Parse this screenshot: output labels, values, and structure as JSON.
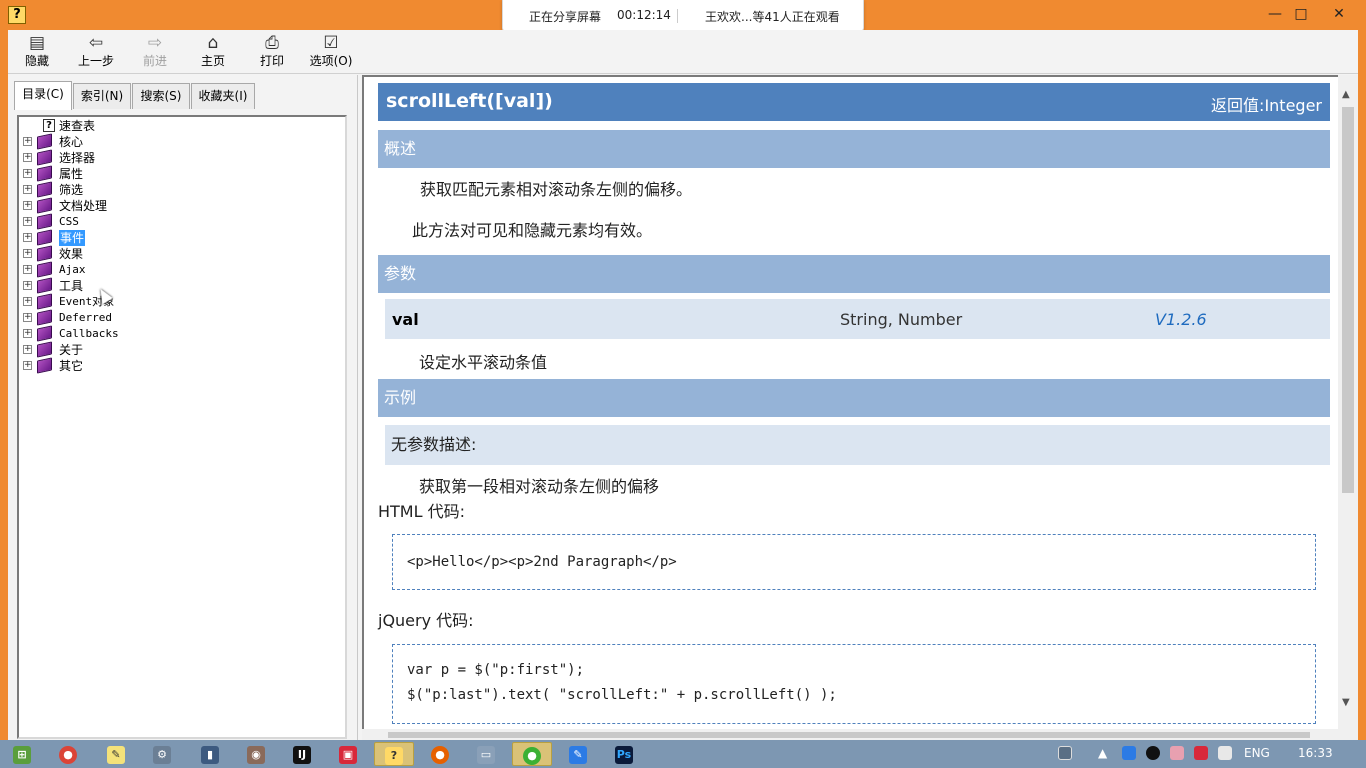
{
  "window": {
    "app_icon": "help-file-icon",
    "minimize": "—",
    "maximize": "□",
    "close": "✕"
  },
  "share_banner": {
    "status": "正在分享屏幕",
    "time": "00:12:14",
    "viewers": "王欢欢...等41人正在观看"
  },
  "toolbar": {
    "hide": "隐藏",
    "back": "上一步",
    "forward": "前进",
    "home": "主页",
    "print": "打印",
    "options": "选项(O)"
  },
  "tabs": {
    "contents": "目录(C)",
    "index": "索引(N)",
    "search": "搜索(S)",
    "favorites": "收藏夹(I)"
  },
  "tree": {
    "quick_ref": "速查表",
    "items": [
      "核心",
      "选择器",
      "属性",
      "筛选",
      "文档处理",
      "CSS",
      "事件",
      "效果",
      "Ajax",
      "工具",
      "Event对象",
      "Deferred",
      "Callbacks",
      "关于",
      "其它"
    ],
    "selected": "事件"
  },
  "doc": {
    "title": "scrollLeft([val])",
    "return_label": "返回值:Integer",
    "overview_heading": "概述",
    "overview_text": "获取匹配元素相对滚动条左侧的偏移。",
    "overview_note": "此方法对可见和隐藏元素均有效。",
    "params_heading": "参数",
    "param_name": "val",
    "param_type": "String, Number",
    "param_version": "V1.2.6",
    "param_desc": "设定水平滚动条值",
    "example_heading": "示例",
    "example_title": "无参数描述:",
    "example_desc": "获取第一段相对滚动条左侧的偏移",
    "html_label": "HTML 代码:",
    "html_code": "<p>Hello</p><p>2nd Paragraph</p>",
    "jquery_label": "jQuery 代码:",
    "jquery_code_1": "var p = $(\"p:first\");",
    "jquery_code_2": "$(\"p:last\").text( \"scrollLeft:\" + p.scrollLeft() );"
  },
  "taskbar": {
    "apps": [
      "start-icon",
      "chrome-icon",
      "notepad-icon",
      "settings-icon",
      "file-icon",
      "media-icon",
      "intellij-icon",
      "app-icon",
      "help-icon",
      "firefox-icon",
      "remote-icon",
      "wechat-icon",
      "feishu-icon",
      "photoshop-icon"
    ],
    "lang": "ENG",
    "clock": "16:33"
  },
  "colors": {
    "title_bar": "#f08a30",
    "header_blue": "#4f81bd",
    "section_blue": "#95b3d7",
    "row_blue": "#dbe5f1",
    "taskbar": "#7d97b2"
  }
}
